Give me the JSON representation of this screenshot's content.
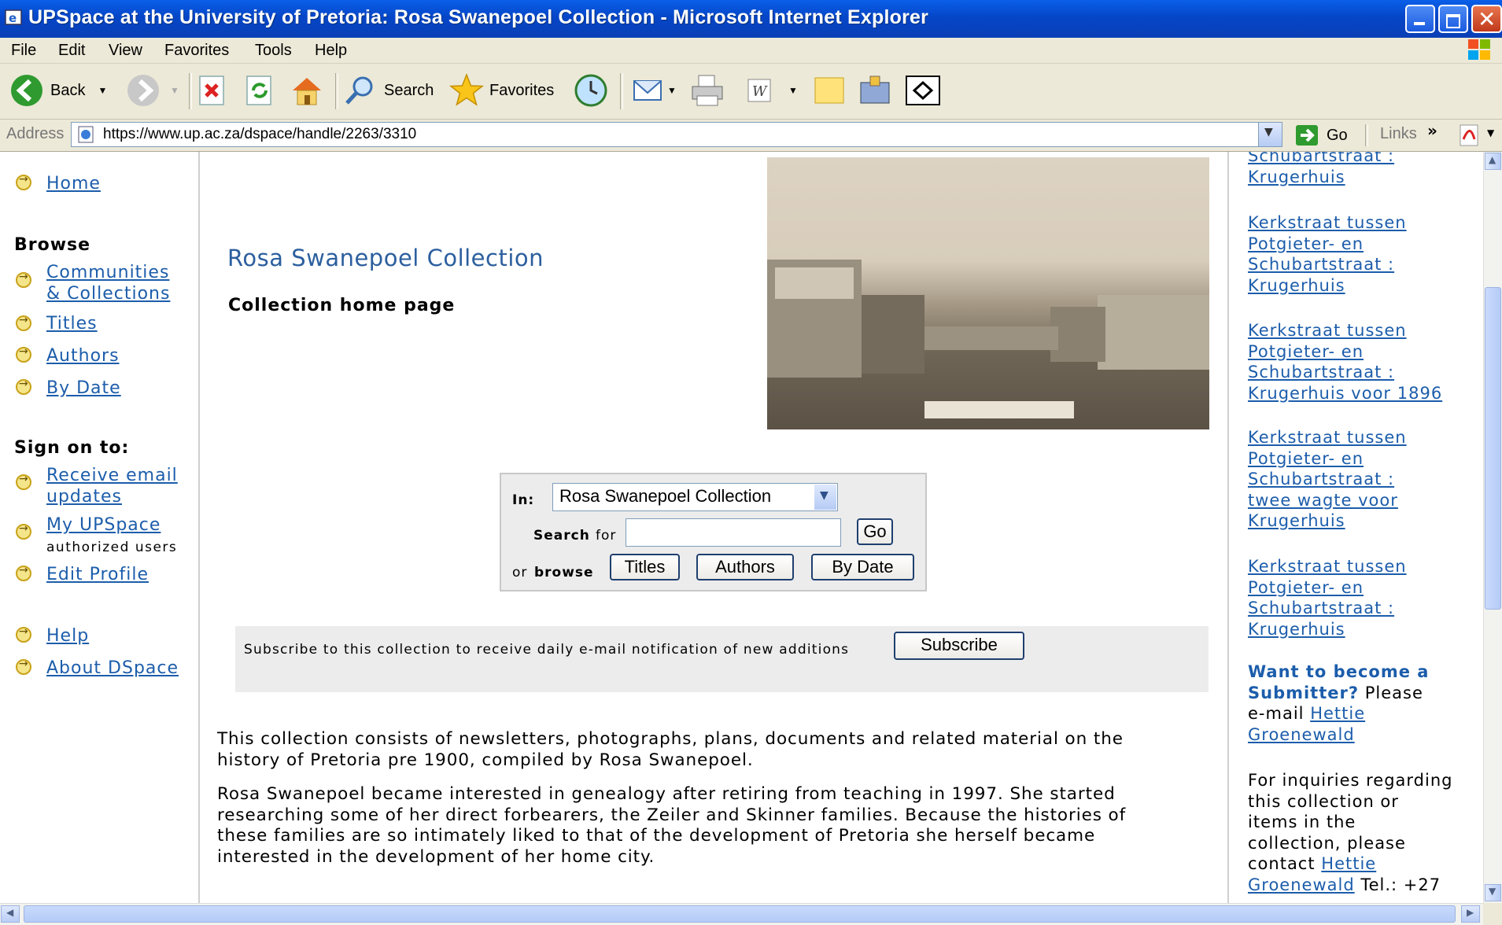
{
  "window": {
    "title": "UPSpace at the University of Pretoria: Rosa Swanepoel Collection - Microsoft Internet Explorer"
  },
  "menu": [
    "File",
    "Edit",
    "View",
    "Favorites",
    "Tools",
    "Help"
  ],
  "toolbar": {
    "back": "Back",
    "search": "Search",
    "favorites": "Favorites"
  },
  "address": {
    "label": "Address",
    "url": "https://www.up.ac.za/dspace/handle/2263/3310",
    "go": "Go",
    "links": "Links"
  },
  "nav": {
    "home": "Home",
    "browse_heading": "Browse",
    "communities_line1": "Communities",
    "communities_line2": "& Collections",
    "titles": "Titles",
    "authors": "Authors",
    "by_date": "By Date",
    "signon_heading": "Sign on to:",
    "receive_line1": "Receive email",
    "receive_line2": "updates",
    "my_upspace": "My UPSpace",
    "authorized_users": "authorized users",
    "edit_profile": "Edit Profile",
    "help": "Help",
    "about": "About DSpace"
  },
  "main": {
    "collection_title": "Rosa Swanepoel Collection",
    "subtitle": "Collection home page",
    "search": {
      "in_label": "In:",
      "scope_value": "Rosa Swanepoel Collection",
      "search_label": "Search",
      "for_label": "for",
      "go": "Go",
      "or_label": "or",
      "browse_label": "browse",
      "titles": "Titles",
      "authors": "Authors",
      "by_date": "By Date"
    },
    "subscribe": {
      "text": "Subscribe to this collection to receive daily e-mail notification of new additions",
      "button": "Subscribe"
    },
    "paragraph1": [
      "This collection consists of newsletters, photographs, plans, documents and related material on the",
      "history of Pretoria pre 1900, compiled by Rosa Swanepoel."
    ],
    "paragraph2": [
      "Rosa Swanepoel became interested in genealogy after retiring from teaching in 1997. She started",
      "researching some of her direct forbearers, the Zeiler and Skinner families. Because the histories of",
      "these families are so intimately liked to that of the development of Pretoria she herself became",
      "interested in the development of her home city."
    ]
  },
  "sidebar": {
    "item0": [
      "Schubartstraat :",
      "Krugerhuis"
    ],
    "item1": [
      "Kerkstraat tussen",
      "Potgieter- en",
      "Schubartstraat :",
      "Krugerhuis"
    ],
    "item2": [
      "Kerkstraat tussen",
      "Potgieter- en",
      "Schubartstraat :",
      "Krugerhuis voor 1896"
    ],
    "item3": [
      "Kerkstraat tussen",
      "Potgieter- en",
      "Schubartstraat :",
      "twee wagte voor",
      "Krugerhuis"
    ],
    "item4": [
      "Kerkstraat tussen",
      "Potgieter- en",
      "Schubartstraat :",
      "Krugerhuis"
    ],
    "submitter_heading_line1": "Want to become a",
    "submitter_heading_line2": "Submitter?",
    "please": "Please",
    "email_prefix": "e-mail",
    "contact_first": "Hettie",
    "contact_last": "Groenewald",
    "inquiry_lines": [
      "For inquiries regarding",
      "this collection or",
      "items in the",
      "collection, please"
    ],
    "contact_word": "contact",
    "tel": "Tel.: +27"
  }
}
